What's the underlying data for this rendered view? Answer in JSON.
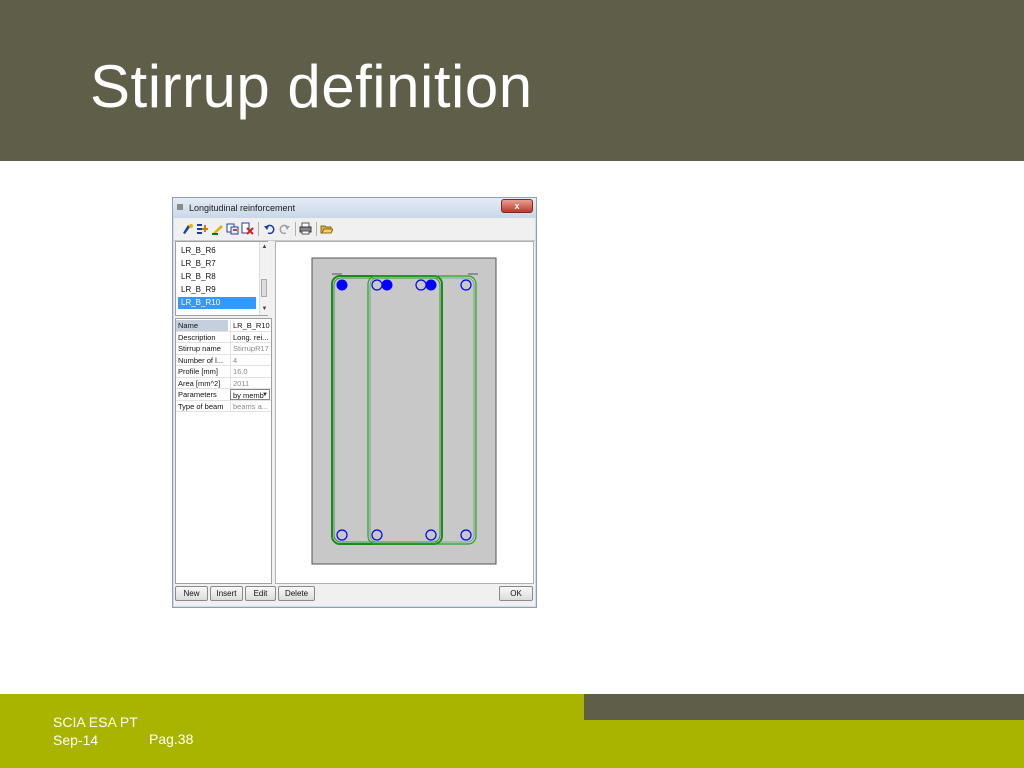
{
  "slide": {
    "title": "Stirrup definition",
    "footer": {
      "company": "SCIA ESA PT",
      "date": "Sep-14",
      "page": "Pag.38"
    },
    "colors": {
      "header": "#5e5e49",
      "footer": "#a8b400",
      "footer_strip": "#5e5e49"
    }
  },
  "window": {
    "title": "Longitudinal reinforcement",
    "close_label": "x",
    "toolbar": [
      "select-icon",
      "add-icon",
      "edit-icon",
      "copy-icon",
      "delete-icon",
      "undo-icon",
      "redo-icon",
      "print-icon",
      "open-folder-icon"
    ],
    "list": {
      "items": [
        "LR_B_R6",
        "LR_B_R7",
        "LR_B_R8",
        "LR_B_R9",
        "LR_B_R10"
      ],
      "selected": "LR_B_R10"
    },
    "properties": [
      {
        "name": "Name",
        "value": "LR_B_R10"
      },
      {
        "name": "Description",
        "value": "Long. rei..."
      },
      {
        "name": "Stirrup name",
        "value": "StirrupR17"
      },
      {
        "name": "Number of l...",
        "value": "4"
      },
      {
        "name": "Profile [mm]",
        "value": "16.0"
      },
      {
        "name": "Area [mm^2]",
        "value": "2011"
      },
      {
        "name": "Parameters",
        "value": "by memb"
      },
      {
        "name": "Type of beam",
        "value": "beams a..."
      }
    ],
    "buttons": {
      "new": "New",
      "insert": "Insert",
      "edit": "Edit",
      "delete": "Delete",
      "ok": "OK"
    },
    "colors": {
      "bar_filled": "#0000ff",
      "stirrup": "#1a8a1a",
      "section": "#c8c8c8"
    }
  }
}
